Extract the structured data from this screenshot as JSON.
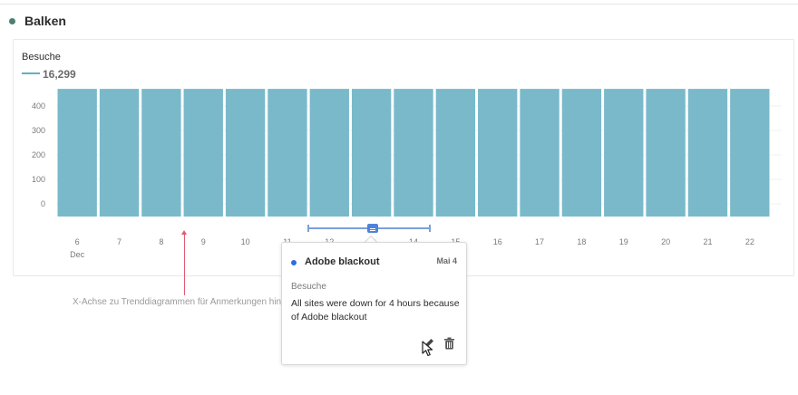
{
  "panel": {
    "title": "Balken"
  },
  "summary": {
    "metric": "Besuche",
    "total": "16,299"
  },
  "chart_data": {
    "type": "bar",
    "title": "",
    "xlabel": "",
    "ylabel": "",
    "ylim": [
      0,
      400
    ],
    "yticks": [
      "400",
      "300",
      "200",
      "100",
      "0"
    ],
    "categories": [
      "6",
      "7",
      "8",
      "9",
      "10",
      "11",
      "12",
      "13",
      "14",
      "15",
      "16",
      "17",
      "18",
      "19",
      "20",
      "21",
      "22"
    ],
    "month_label": "Dec",
    "series": [
      {
        "values": [
          470,
          470,
          470,
          470,
          470,
          470,
          470,
          470,
          470,
          470,
          470,
          470,
          470,
          470,
          470,
          470,
          470
        ]
      }
    ],
    "bar_color": "#7ab9c9",
    "grid": true
  },
  "annotation": {
    "title": "Adobe blackout",
    "date": "Mai 4",
    "metric": "Besuche",
    "description": "All sites were down for 4 hours because of Adobe blackout",
    "color": "#2a6fdb",
    "actions": {
      "edit_icon": "pencil-icon",
      "delete_icon": "trash-icon"
    }
  },
  "caption": "X-Achse zu Trenddiagrammen für Anmerkungen hinzufügen",
  "colors": {
    "accent": "#4f82dd",
    "guide": "#e05a6f",
    "header_dot": "#4d7f73"
  }
}
